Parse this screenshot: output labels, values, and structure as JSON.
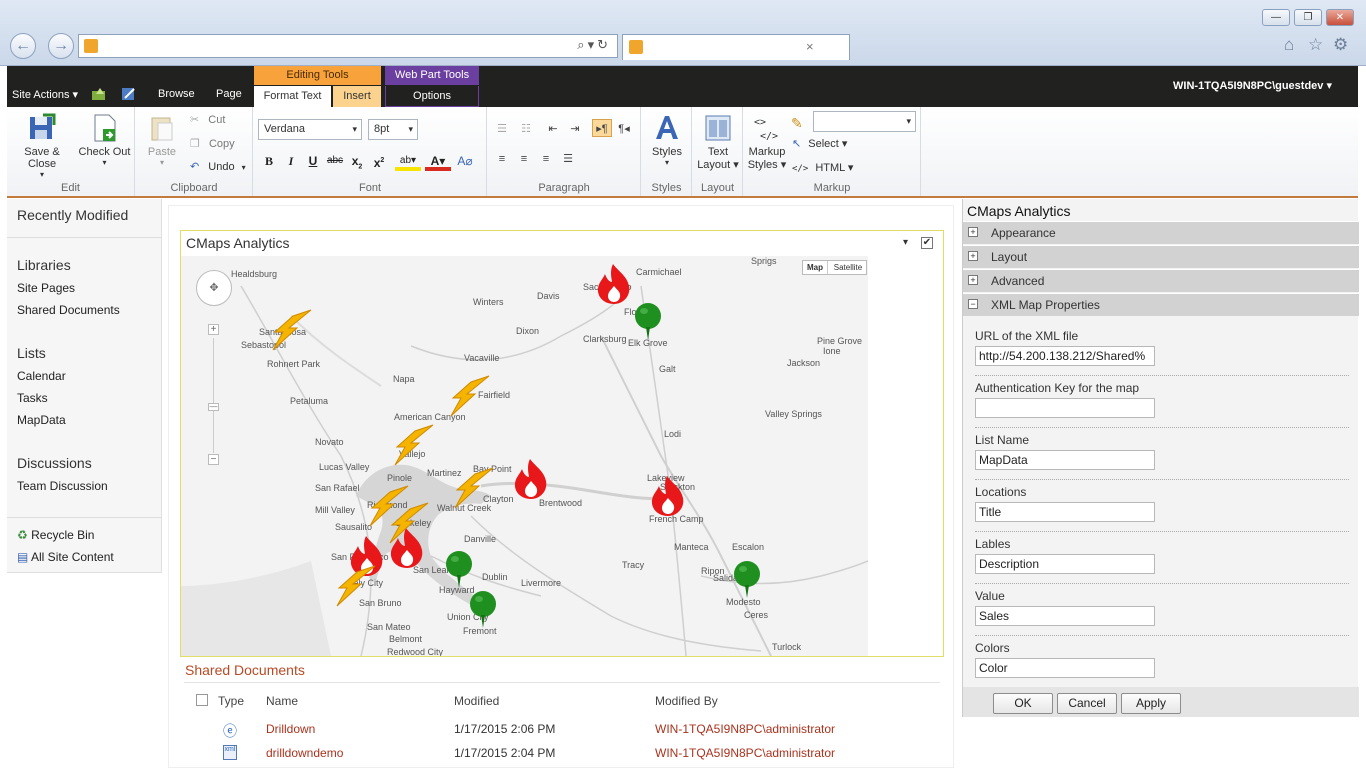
{
  "browser": {
    "back": "←",
    "forward": "→",
    "addr_tools": "⌕▾↻",
    "tab_close": "×",
    "win_min": "—",
    "win_max": "❐",
    "win_close": "✕",
    "home_icon": "⌂",
    "star_icon": "☆",
    "gear_icon": "⚙"
  },
  "topbar": {
    "site_actions": "Site Actions ▾",
    "browse": "Browse",
    "page": "Page",
    "editing_tools": "Editing Tools",
    "format_text": "Format Text",
    "insert": "Insert",
    "web_part_tools": "Web Part Tools",
    "options": "Options",
    "user": "WIN-1TQA5I9N8PC\\guestdev ▾"
  },
  "ribbon": {
    "edit": {
      "label": "Edit",
      "save_close": "Save & Close",
      "check_out": "Check Out"
    },
    "clipboard": {
      "label": "Clipboard",
      "paste": "Paste",
      "cut": "Cut",
      "copy": "Copy",
      "undo": "Undo"
    },
    "font": {
      "label": "Font",
      "family": "Verdana",
      "size": "8pt"
    },
    "paragraph": {
      "label": "Paragraph"
    },
    "styles": {
      "label": "Styles",
      "btn": "Styles"
    },
    "layout": {
      "label": "Layout",
      "btn_line1": "Text",
      "btn_line2": "Layout ▾"
    },
    "markup": {
      "label": "Markup",
      "btn_line1": "Markup",
      "btn_line2": "Styles ▾",
      "select": "Select ▾",
      "html": "HTML ▾"
    }
  },
  "leftnav": {
    "recently_modified": "Recently Modified",
    "libraries": "Libraries",
    "lib_items": [
      "Site Pages",
      "Shared Documents"
    ],
    "lists": "Lists",
    "list_items": [
      "Calendar",
      "Tasks",
      "MapData"
    ],
    "discussions": "Discussions",
    "disc_items": [
      "Team Discussion"
    ],
    "recycle_bin": "Recycle Bin",
    "all_site_content": "All Site Content"
  },
  "webpart": {
    "title": "CMaps Analytics",
    "menu": "▾",
    "map_btn": "Map",
    "satellite_btn": "Satellite"
  },
  "map": {
    "cities": [
      "Healdsburg",
      "Santa Rosa",
      "Sebastopol",
      "Rohnert Park",
      "Petaluma",
      "Novato",
      "Lucas Valley",
      "San Rafael",
      "Mill Valley",
      "Sausalito",
      "San Francisco",
      "Daly City",
      "San Bruno",
      "San Mateo",
      "Belmont",
      "Redwood City",
      "Napa",
      "American Canyon",
      "Vallejo",
      "Pinole",
      "Richmond",
      "Berkeley",
      "Martinez",
      "Bay Point",
      "Walnut Creek",
      "Clayton",
      "Brentwood",
      "Danville",
      "San Leandro",
      "Hayward",
      "Dublin",
      "Livermore",
      "Union City",
      "Fremont",
      "Winters",
      "Davis",
      "Dixon",
      "Vacaville",
      "Fairfield",
      "Sacramento",
      "Carmichael",
      "Florin",
      "Elk Grove",
      "Clarksburg",
      "Galt",
      "Lodi",
      "Lakeview",
      "Stockton",
      "French Camp",
      "Manteca",
      "Tracy",
      "Escalon",
      "Ripon",
      "Salida",
      "Modesto",
      "Ceres",
      "Turlock",
      "Pine Grove",
      "Ione",
      "Jackson",
      "Valley Springs",
      "Sprigs"
    ]
  },
  "documents": {
    "title": "Shared Documents",
    "headers": {
      "type": "Type",
      "name": "Name",
      "modified": "Modified",
      "modified_by": "Modified By"
    },
    "rows": [
      {
        "name": "Drilldown",
        "modified": "1/17/2015 2:06 PM",
        "modified_by": "WIN-1TQA5I9N8PC\\administrator"
      },
      {
        "name": "drilldowndemo",
        "modified": "1/17/2015 2:04 PM",
        "modified_by": "WIN-1TQA5I9N8PC\\administrator"
      }
    ]
  },
  "toolpane": {
    "title": "CMaps Analytics",
    "sections": [
      "Appearance",
      "Layout",
      "Advanced",
      "XML Map Properties"
    ],
    "fields": [
      {
        "label": "URL of the XML file",
        "value": "http://54.200.138.212/Shared%"
      },
      {
        "label": "Authentication Key for the map",
        "value": ""
      },
      {
        "label": "List Name",
        "value": "MapData"
      },
      {
        "label": "Locations",
        "value": "Title"
      },
      {
        "label": "Lables",
        "value": "Description"
      },
      {
        "label": "Value",
        "value": "Sales"
      },
      {
        "label": "Colors",
        "value": "Color"
      }
    ],
    "ok": "OK",
    "cancel": "Cancel",
    "apply": "Apply"
  },
  "colors": {
    "ribbon_dark": "#21211f",
    "editing_tools": "#f7a23b",
    "web_part_tools": "#6b3fa0",
    "link_red": "#a9331e",
    "fire": "#e8181a",
    "lightning": "#f4b400",
    "pin_green": "#1f8f1f"
  }
}
